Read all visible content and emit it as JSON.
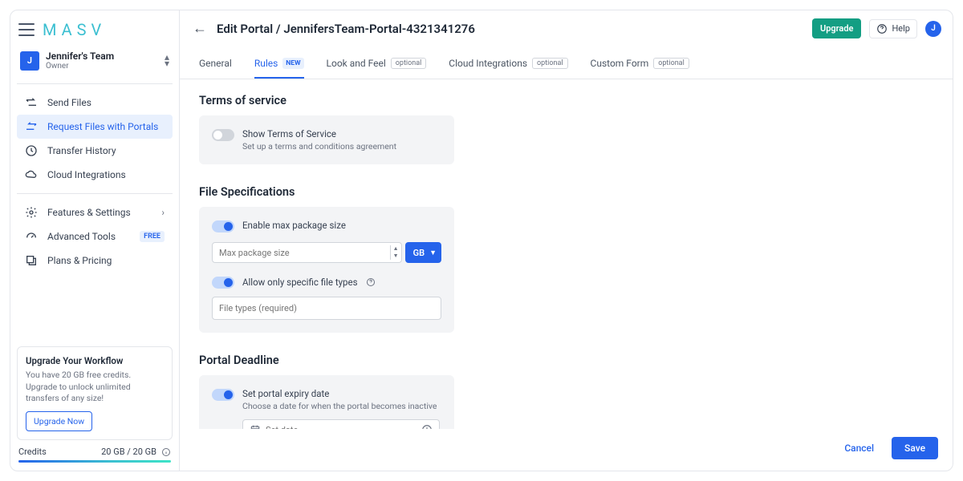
{
  "logo": "MASV",
  "team": {
    "initial": "J",
    "name": "Jennifer's Team",
    "role": "Owner"
  },
  "nav": {
    "send": "Send Files",
    "request": "Request Files with Portals",
    "history": "Transfer History",
    "cloud": "Cloud Integrations",
    "features": "Features & Settings",
    "advanced": "Advanced Tools",
    "advanced_badge": "FREE",
    "plans": "Plans & Pricing"
  },
  "promo": {
    "title": "Upgrade Your Workflow",
    "text": "You have 20 GB free credits. Upgrade to unlock unlimited transfers of any size!",
    "btn": "Upgrade Now"
  },
  "credits": {
    "label": "Credits",
    "value": "20 GB / 20 GB"
  },
  "header": {
    "title": "Edit Portal / JennifersTeam-Portal-4321341276",
    "upgrade": "Upgrade",
    "help": "Help",
    "avatar": "J"
  },
  "tabs": {
    "general": "General",
    "rules": "Rules",
    "rules_badge": "NEW",
    "look": "Look and Feel",
    "cloud": "Cloud Integrations",
    "form": "Custom Form",
    "optional": "optional"
  },
  "tos": {
    "heading": "Terms of service",
    "toggle_label": "Show Terms of Service",
    "toggle_sub": "Set up a terms and conditions agreement"
  },
  "filespec": {
    "heading": "File Specifications",
    "maxpkg_label": "Enable max package size",
    "maxpkg_placeholder": "Max package size",
    "unit": "GB",
    "filetypes_label": "Allow only specific file types",
    "filetypes_placeholder": "File types (required)"
  },
  "deadline": {
    "heading": "Portal Deadline",
    "toggle_label": "Set portal expiry date",
    "toggle_sub": "Choose a date for when the portal becomes inactive",
    "date_placeholder": "Set date"
  },
  "footer": {
    "cancel": "Cancel",
    "save": "Save"
  }
}
